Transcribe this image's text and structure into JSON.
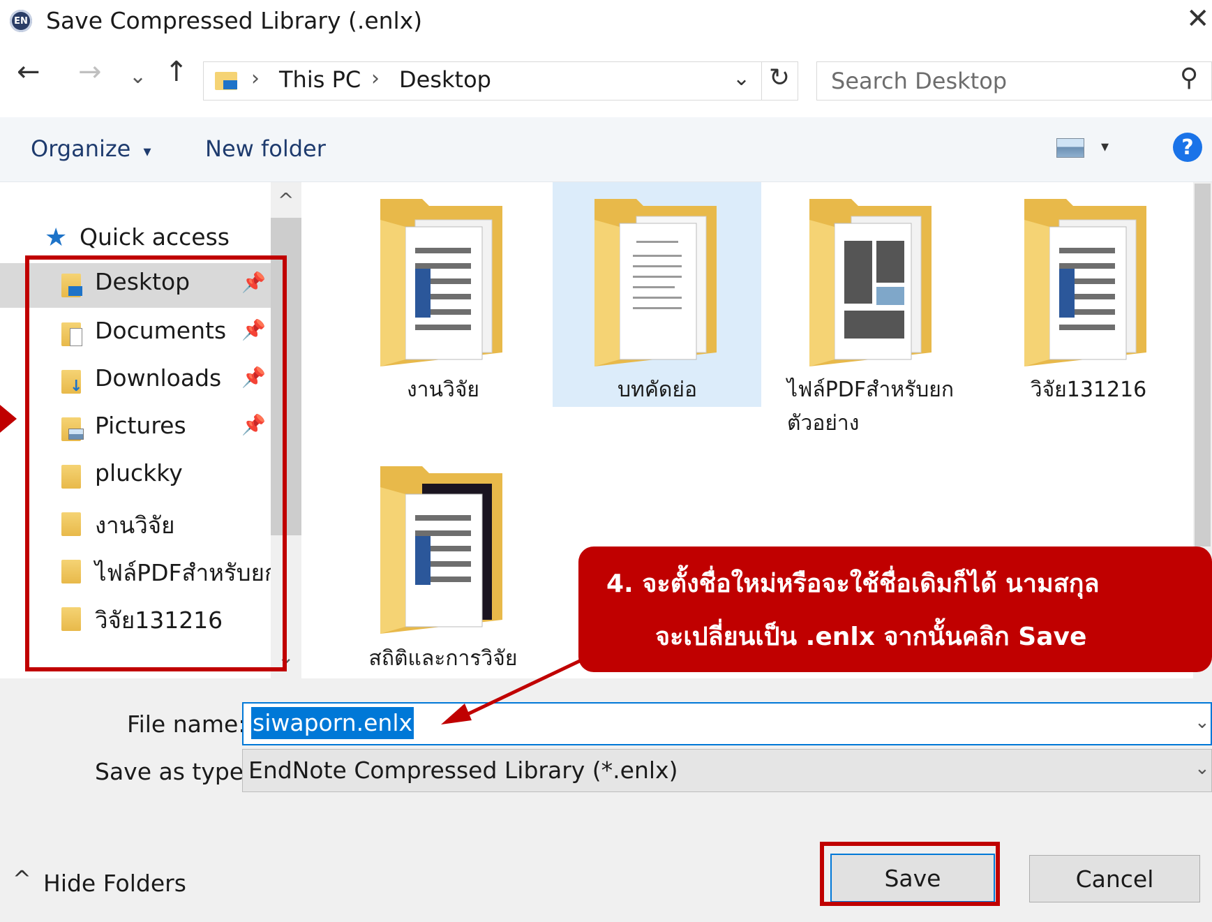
{
  "window": {
    "title": "Save Compressed Library (.enlx)",
    "logo_text": "EN",
    "close_glyph": "✕"
  },
  "nav": {
    "back_glyph": "←",
    "forward_glyph": "→",
    "recent_glyph": "⌄",
    "up_glyph": "↑",
    "refresh_glyph": "↻"
  },
  "address": {
    "crumbs": [
      "This PC",
      "Desktop"
    ],
    "separator": "›",
    "dropdown_glyph": "⌄"
  },
  "search": {
    "placeholder": "Search Desktop",
    "icon_glyph": "⚲"
  },
  "toolbar": {
    "organize_label": "Organize",
    "organize_caret": "▾",
    "new_folder_label": "New folder",
    "view_caret": "▾",
    "help_glyph": "?"
  },
  "sidebar": {
    "scroll_up_glyph": "^",
    "scroll_down_glyph": "⌄",
    "quick_access_label": "Quick access",
    "items": [
      {
        "label": "Desktop",
        "pinned": true
      },
      {
        "label": "Documents",
        "pinned": true
      },
      {
        "label": "Downloads",
        "pinned": true
      },
      {
        "label": "Pictures",
        "pinned": true
      },
      {
        "label": "pluckky",
        "pinned": false
      },
      {
        "label": "งานวิจัย",
        "pinned": false
      },
      {
        "label": "ไฟล์PDFสำหรับยก",
        "pinned": false
      },
      {
        "label": "วิจัย131216",
        "pinned": false
      }
    ],
    "pin_glyph": "📌"
  },
  "files": [
    {
      "label": "งานวิจัย",
      "label2": ""
    },
    {
      "label": "บทคัดย่อ",
      "label2": ""
    },
    {
      "label": "ไฟล์PDFสำหรับยก",
      "label2": "ตัวอย่าง"
    },
    {
      "label": "วิจัย131216",
      "label2": ""
    },
    {
      "label": "สถิติและการวิจัย",
      "label2": ""
    }
  ],
  "form": {
    "file_name_label": "File name:",
    "file_name_value": "siwaporn.enlx",
    "save_type_label": "Save as type:",
    "save_type_value": "EndNote Compressed Library (*.enlx)",
    "dropdown_glyph": "⌄"
  },
  "footer": {
    "hide_folders_glyph": "^",
    "hide_folders_label": "Hide Folders",
    "save_label": "Save",
    "cancel_label": "Cancel"
  },
  "annotation": {
    "line1": "4. จะตั้งชื่อใหม่หรือจะใช้ชื่อเดิมก็ได้ นามสกุล",
    "line2": "จะเปลี่ยนเป็น .enlx จากนั้นคลิก Save",
    "color": "#c00000"
  },
  "colors": {
    "accent": "#0078d7",
    "folder": "#f5d374"
  }
}
